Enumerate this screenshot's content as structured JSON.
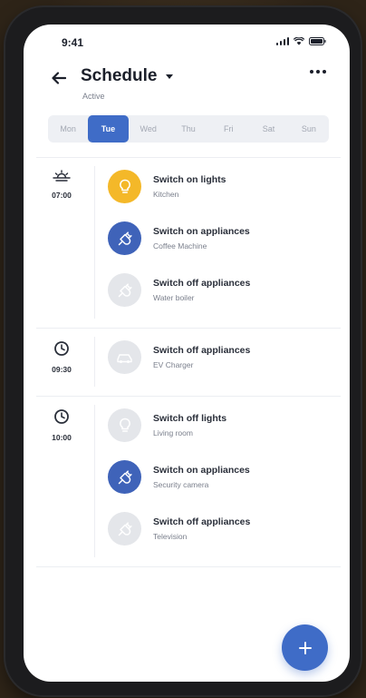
{
  "status_bar": {
    "time": "9:41"
  },
  "header": {
    "title": "Schedule",
    "subtitle": "Active"
  },
  "days": [
    {
      "label": "Mon",
      "active": false
    },
    {
      "label": "Tue",
      "active": true
    },
    {
      "label": "Wed",
      "active": false
    },
    {
      "label": "Thu",
      "active": false
    },
    {
      "label": "Fri",
      "active": false
    },
    {
      "label": "Sat",
      "active": false
    },
    {
      "label": "Sun",
      "active": false
    }
  ],
  "groups": [
    {
      "time": "07:00",
      "time_icon": "sunrise-icon",
      "actions": [
        {
          "title": "Switch on lights",
          "device": "Kitchen",
          "icon": "lightbulb-icon",
          "state": "active-yellow"
        },
        {
          "title": "Switch on appliances",
          "device": "Coffee Machine",
          "icon": "plug-icon",
          "state": "active-blue"
        },
        {
          "title": "Switch off appliances",
          "device": "Water boiler",
          "icon": "plug-icon",
          "state": "inactive"
        }
      ]
    },
    {
      "time": "09:30",
      "time_icon": "clock-icon",
      "actions": [
        {
          "title": "Switch off appliances",
          "device": "EV Charger",
          "icon": "ev-charger-icon",
          "state": "inactive"
        }
      ]
    },
    {
      "time": "10:00",
      "time_icon": "clock-icon",
      "actions": [
        {
          "title": "Switch off lights",
          "device": "Living room",
          "icon": "lightbulb-icon",
          "state": "inactive"
        },
        {
          "title": "Switch on appliances",
          "device": "Security camera",
          "icon": "plug-icon",
          "state": "active-blue"
        },
        {
          "title": "Switch off appliances",
          "device": "Television",
          "icon": "plug-icon",
          "state": "inactive"
        }
      ]
    }
  ],
  "colors": {
    "accent": "#3f6cc7",
    "active_blue": "#3f63b9",
    "active_yellow": "#f4b829",
    "inactive": "#e4e6ea"
  }
}
